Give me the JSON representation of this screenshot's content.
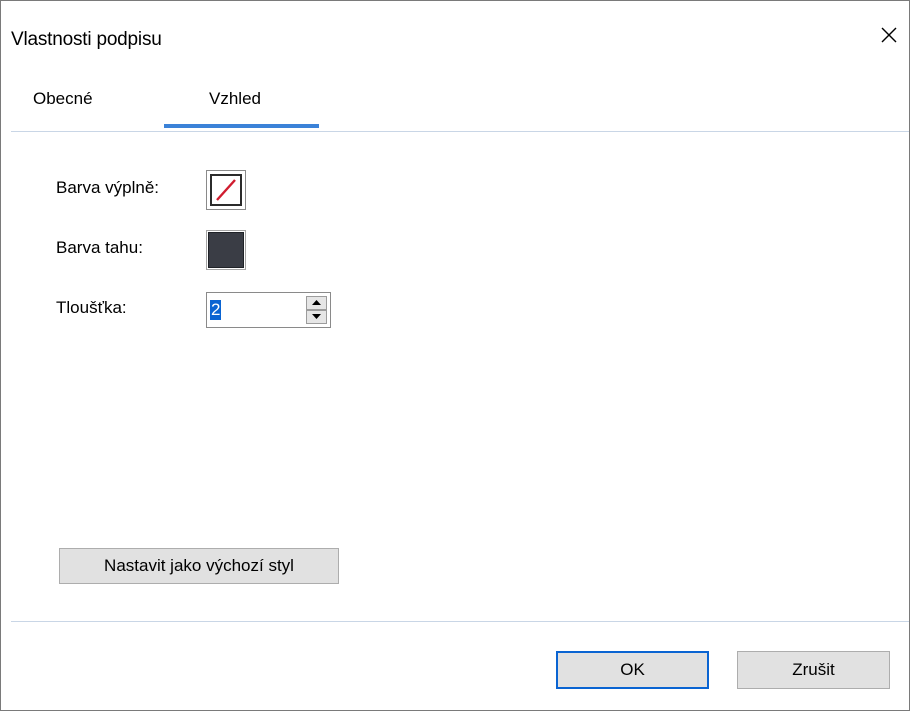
{
  "window": {
    "title": "Vlastnosti podpisu",
    "close_icon": "close-icon"
  },
  "tabs": [
    {
      "label": "Obecné",
      "selected": false
    },
    {
      "label": "Vzhled",
      "selected": true
    }
  ],
  "appearance": {
    "fill_color_label": "Barva výplně:",
    "fill_color": "none",
    "stroke_color_label": "Barva tahu:",
    "stroke_color": "#3a3d45",
    "thickness_label": "Tloušťka:",
    "thickness_value": "2"
  },
  "buttons": {
    "default_style": "Nastavit jako výchozí styl",
    "ok": "OK",
    "cancel": "Zrušit"
  },
  "colors": {
    "accent": "#3b82d8",
    "selection": "#0a64d2",
    "no_fill_slash": "#d01c2f"
  }
}
